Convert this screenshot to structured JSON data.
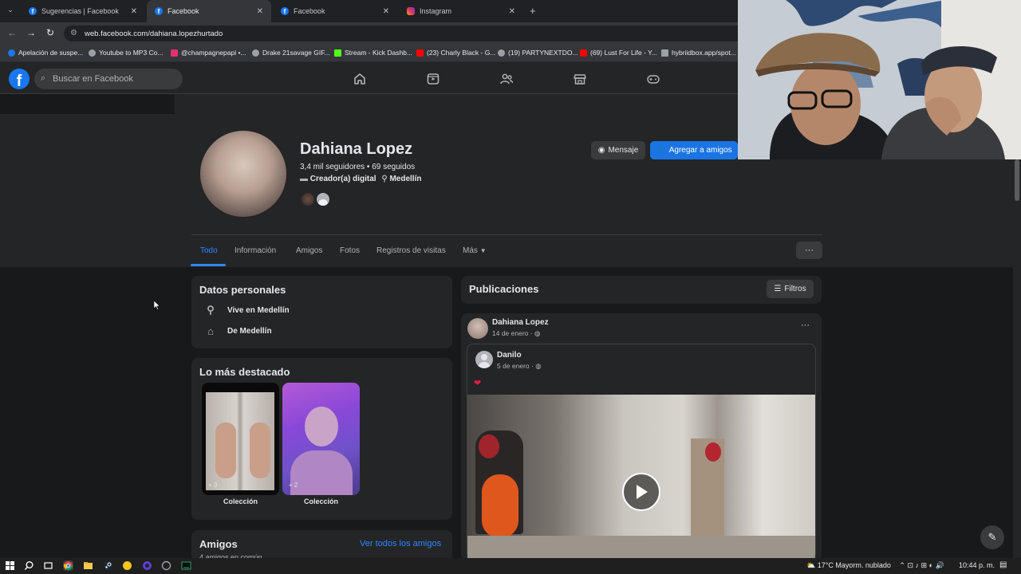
{
  "browser": {
    "tabs": [
      {
        "title": "Sugerencias | Facebook",
        "icon": "facebook-icon",
        "active": false
      },
      {
        "title": "Facebook",
        "icon": "facebook-icon",
        "active": true
      },
      {
        "title": "Facebook",
        "icon": "facebook-icon",
        "active": false
      },
      {
        "title": "Instagram",
        "icon": "instagram-icon",
        "active": false
      }
    ],
    "url": "web.facebook.com/dahiana.lopezhurtado",
    "bookmarks": [
      {
        "label": "Apelación de suspe...",
        "color": "#1877f2"
      },
      {
        "label": "Youtube to MP3 Co...",
        "color": "#9aa0a6"
      },
      {
        "label": "@champagnepapi •...",
        "color": "#e1306c"
      },
      {
        "label": "Drake 21savage GIF...",
        "color": "#9aa0a6"
      },
      {
        "label": "Stream - Kick Dashb...",
        "color": "#53fc18"
      },
      {
        "label": "(23) Charly Black - G...",
        "color": "#ff0000"
      },
      {
        "label": "(19) PARTYNEXTDO...",
        "color": "#9aa0a6"
      },
      {
        "label": "(69) Lust For Life - Y...",
        "color": "#ff0000"
      },
      {
        "label": "hybriidbox.app/spot...",
        "color": "#9aa0a6"
      }
    ]
  },
  "facebook": {
    "search_placeholder": "Buscar en Facebook",
    "profile": {
      "name": "Dahiana Lopez",
      "stats": "3,4 mil seguidores • 69 seguidos",
      "category": "Creador(a) digital",
      "location": "Medellín",
      "message_label": "Mensaje",
      "add_friend_label": "Agregar a amigos"
    },
    "tabs": [
      "Todo",
      "Información",
      "Amigos",
      "Fotos",
      "Registros de visitas",
      "Más"
    ],
    "more_dots": "···",
    "personal": {
      "title": "Datos personales",
      "lives_in": "Vive en Medellín",
      "from": "De Medellín"
    },
    "highlights": {
      "title": "Lo más destacado",
      "items": [
        {
          "caption": "Colección",
          "count": "+ 3"
        },
        {
          "caption": "Colección",
          "count": "+ 2"
        }
      ]
    },
    "friends": {
      "title": "Amigos",
      "see_all": "Ver todos los amigos",
      "mutual": "4 amigos en común"
    },
    "posts": {
      "title": "Publicaciones",
      "filters_label": "Filtros",
      "author": "Dahiana Lopez",
      "date": "14 de enero · ",
      "shared_author": "Danilo",
      "shared_date": "5 de enero · ",
      "shared_text": "❤"
    }
  },
  "taskbar": {
    "weather": "17°C  Mayorm. nublado",
    "time": "10:44 p. m."
  }
}
